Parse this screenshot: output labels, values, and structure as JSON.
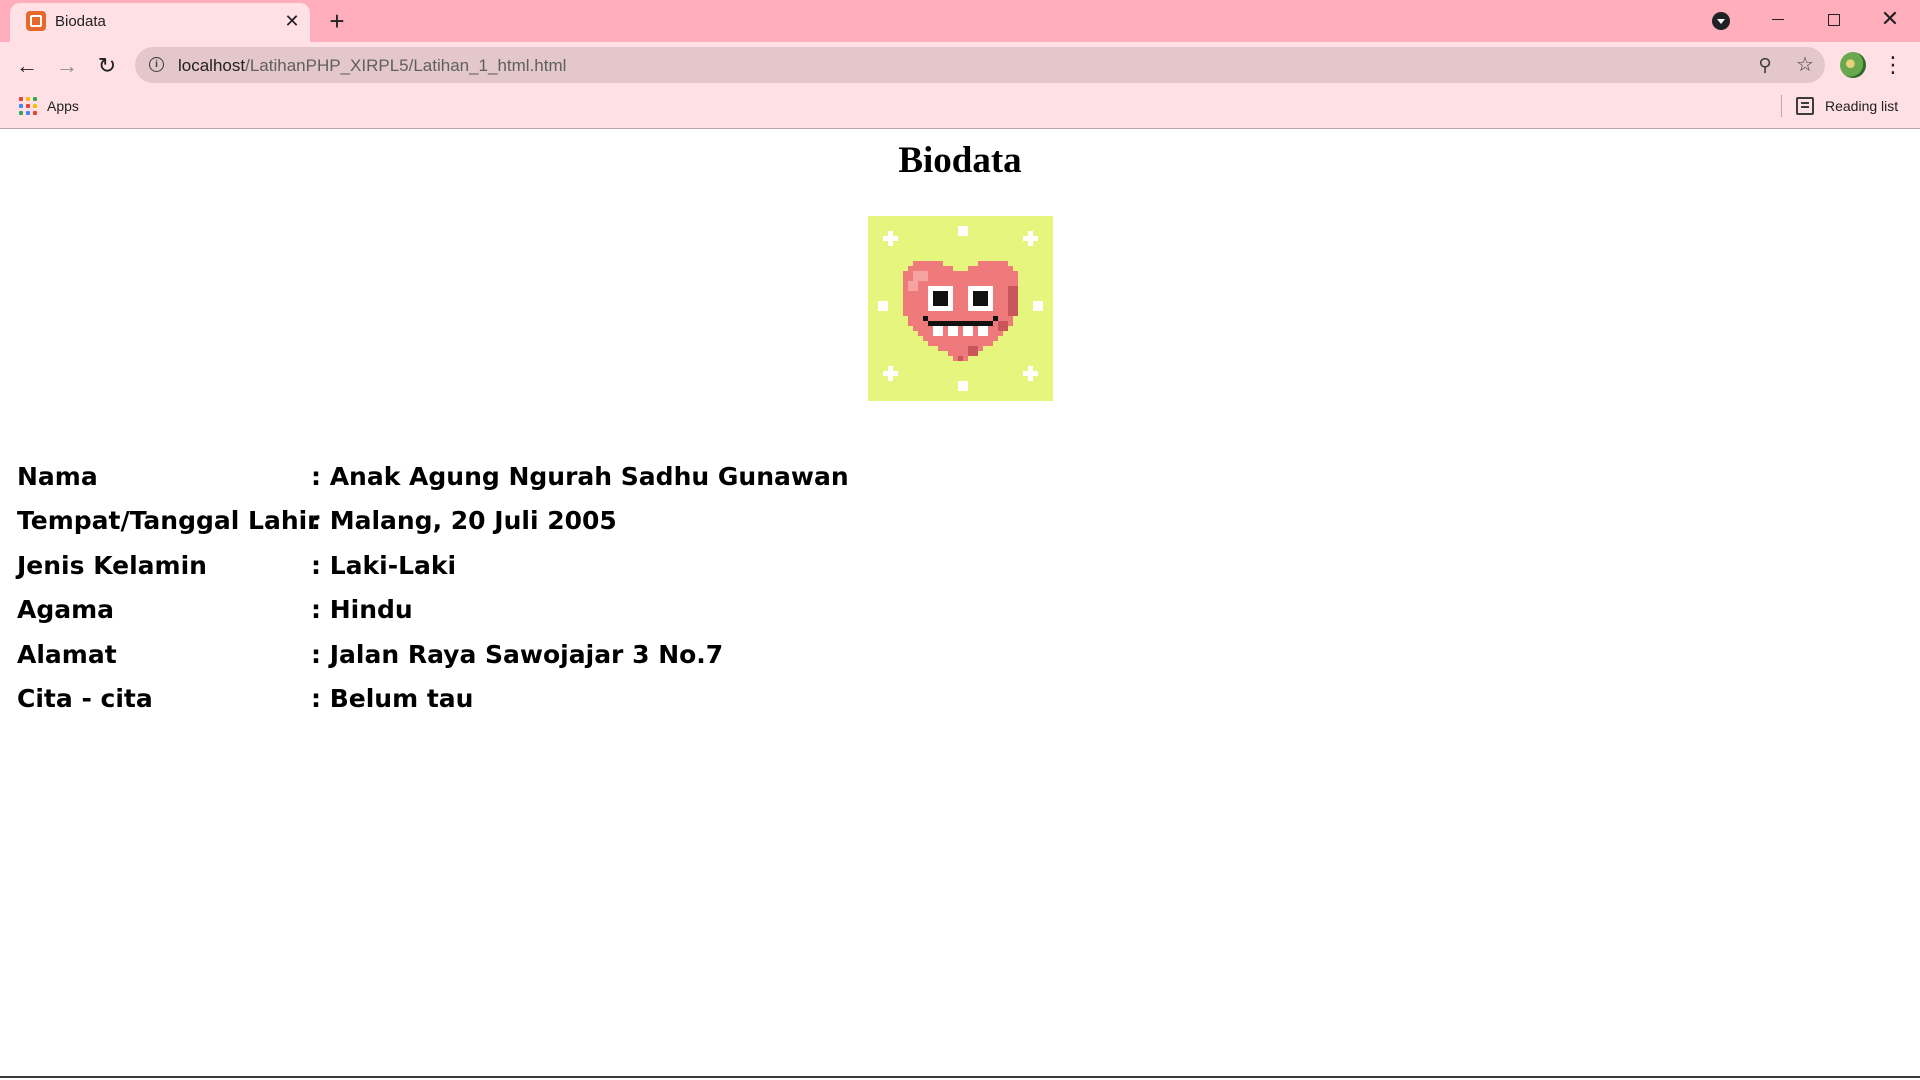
{
  "browser": {
    "tab": {
      "title": "Biodata"
    },
    "address_bar": {
      "url_host": "localhost",
      "url_path": "/LatihanPHP_XIRPL5/Latihan_1_html.html"
    },
    "bookmarks": {
      "apps_label": "Apps",
      "reading_list_label": "Reading list"
    },
    "colors": {
      "tabstrip": "#ffafbb",
      "toolbar": "#ffe0e5",
      "omnibox": "#e3c7cb"
    }
  },
  "page": {
    "title": "Biodata",
    "image": {
      "name": "pixel-heart-character",
      "background": "#e6f57d",
      "heart": "#ee7a7c"
    },
    "fields": [
      {
        "label": "Nama",
        "value": ": Anak Agung Ngurah Sadhu Gunawan"
      },
      {
        "label": "Tempat/Tanggal Lahir",
        "value": ": Malang, 20 Juli 2005"
      },
      {
        "label": "Jenis Kelamin",
        "value": ": Laki-Laki"
      },
      {
        "label": "Agama",
        "value": ": Hindu"
      },
      {
        "label": "Alamat",
        "value": ": Jalan Raya Sawojajar 3 No.7"
      },
      {
        "label": "Cita - cita",
        "value": ": Belum tau"
      }
    ]
  }
}
